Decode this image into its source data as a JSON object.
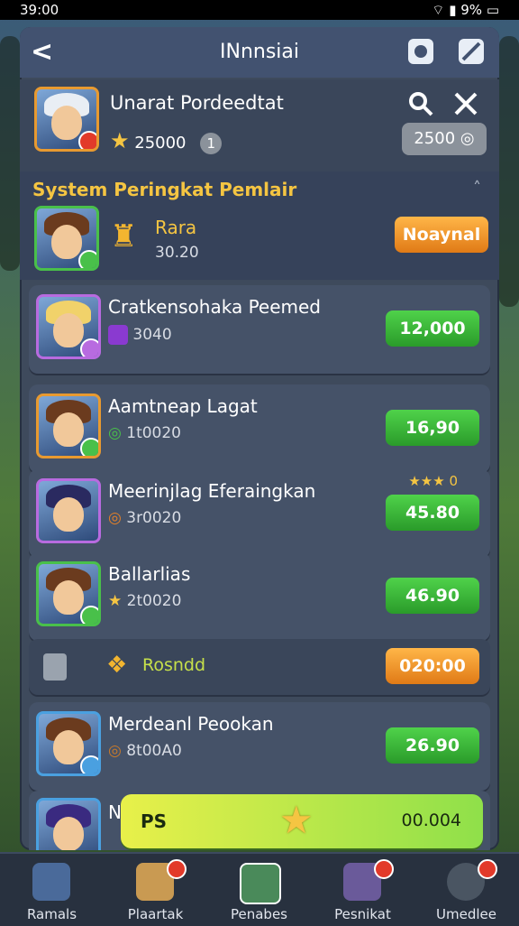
{
  "status": {
    "time": "39:00 ",
    "battery": "9%"
  },
  "header": {
    "title": "INnnsiai"
  },
  "profile": {
    "name": "Unarat Pordeedtat",
    "score": "25000",
    "level": "1",
    "coins": "2500"
  },
  "section": {
    "title": "System Peringkat Pemlair"
  },
  "featured": {
    "name": "Rara",
    "sub": "30.20",
    "button": "Noaynal"
  },
  "list": [
    {
      "name": "Cratkensohaka Peemed",
      "sub": "3040",
      "button": "12,000"
    },
    {
      "name": "Aamtneap Lagat",
      "sub": "1t0020",
      "button": "16,90"
    },
    {
      "name": "Meerinjlag Eferaingkan",
      "sub": "3r0020",
      "button": "45.80",
      "stars": "★★★ 0"
    },
    {
      "name": "Ballarlias",
      "sub": "2t0020",
      "button": "46.90"
    },
    {
      "name": "Rosndd",
      "sub": "",
      "button": "020:00"
    },
    {
      "name": "Merdeanl Peookan",
      "sub": "8t00A0",
      "button": "26.90"
    }
  ],
  "partial": {
    "name": "N",
    "ps": "PS",
    "value": "00.004"
  },
  "nav": [
    {
      "label": "Ramals",
      "color": "#4a6a9a",
      "badge": false
    },
    {
      "label": "Plaartak",
      "color": "#c99a52",
      "badge": true
    },
    {
      "label": "Penabes",
      "color": "#4a8a5a",
      "badge": false
    },
    {
      "label": "Pesnikat",
      "color": "#6a5a9a",
      "badge": true
    },
    {
      "label": "Umedlee",
      "color": "#4a5562",
      "badge": true
    }
  ]
}
